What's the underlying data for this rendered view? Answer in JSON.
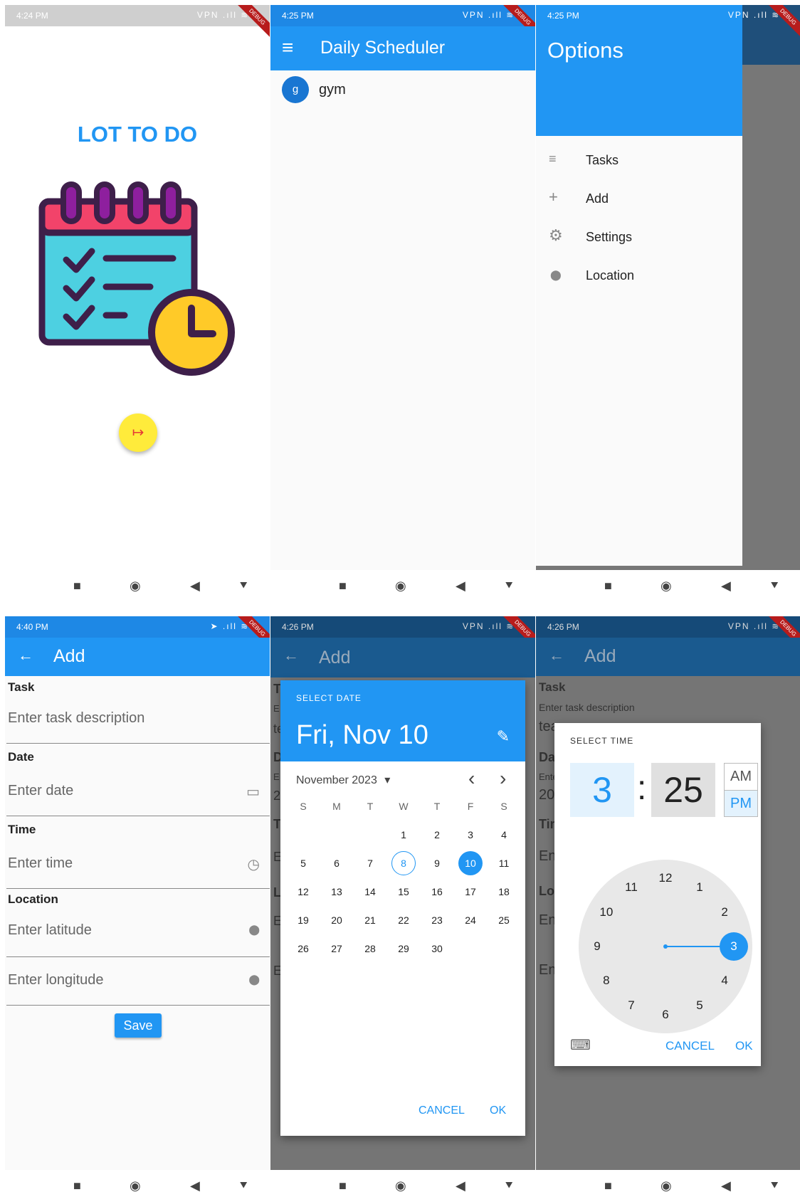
{
  "screen1": {
    "status_time": "4:24 PM",
    "status_icons": "VPN .ıll ≋ ▭",
    "debug": "DEBUG",
    "title": "LOT TO DO",
    "next_icon": "↦"
  },
  "screen2": {
    "status_time": "4:25 PM",
    "status_icons": "VPN .ıll ≋ ▭",
    "debug": "DEBUG",
    "app_title": "Daily Scheduler",
    "menu_icon": "≡",
    "items": [
      {
        "avatar": "g",
        "label": "gym"
      }
    ]
  },
  "screen3": {
    "status_time": "4:25 PM",
    "status_icons": "VPN .ıll ≋ ▭",
    "debug": "DEBUG",
    "drawer_title": "Options",
    "items": [
      {
        "icon": "≡",
        "label": "Tasks"
      },
      {
        "icon": "+",
        "label": "Add"
      },
      {
        "icon": "⚙",
        "label": "Settings"
      },
      {
        "icon": "⬤",
        "label": "Location"
      }
    ]
  },
  "screen4": {
    "status_time": "4:40 PM",
    "status_icons": "➤ .ıll ≋ ▭",
    "debug": "DEBUG",
    "back_icon": "←",
    "app_title": "Add",
    "task_label": "Task",
    "task_placeholder": "Enter task description",
    "date_label": "Date",
    "date_placeholder": "Enter date",
    "time_label": "Time",
    "time_placeholder": "Enter time",
    "location_label": "Location",
    "latitude_placeholder": "Enter latitude",
    "longitude_placeholder": "Enter longitude",
    "save_label": "Save"
  },
  "screen5": {
    "status_time": "4:26 PM",
    "status_icons": "VPN .ıll ≋ ▭",
    "debug": "DEBUG",
    "app_title": "Add",
    "dialog_header": "SELECT DATE",
    "selected_date": "Fri, Nov 10",
    "edit_icon": "✎",
    "month_label": "November 2023",
    "dropdown_icon": "▾",
    "prev_icon": "‹",
    "next_icon": "›",
    "weekdays": [
      "S",
      "M",
      "T",
      "W",
      "T",
      "F",
      "S"
    ],
    "weeks": [
      [
        "",
        "",
        "",
        "1",
        "2",
        "3",
        "4"
      ],
      [
        "5",
        "6",
        "7",
        "8",
        "9",
        "10",
        "11"
      ],
      [
        "12",
        "13",
        "14",
        "15",
        "16",
        "17",
        "18"
      ],
      [
        "19",
        "20",
        "21",
        "22",
        "23",
        "24",
        "25"
      ],
      [
        "26",
        "27",
        "28",
        "29",
        "30",
        "",
        ""
      ]
    ],
    "today": "8",
    "selected": "10",
    "cancel_label": "CANCEL",
    "ok_label": "OK",
    "bg_fragments": [
      "T",
      "E",
      "te",
      "D",
      "E",
      "2",
      "T",
      "E",
      "L",
      "E",
      "E"
    ]
  },
  "screen6": {
    "status_time": "4:26 PM",
    "status_icons": "VPN .ıll ≋ ▭",
    "debug": "DEBUG",
    "back_icon": "←",
    "app_title": "Add",
    "bg_task_label": "Task",
    "bg_task_hint": "Enter task description",
    "bg_task_value": "tea",
    "bg_fragments": [
      "Dat",
      "Ente",
      "202",
      "Tim",
      "Ent",
      "Loc",
      "Ent",
      "Ent"
    ],
    "dialog_header": "SELECT TIME",
    "hour": "3",
    "colon": ":",
    "minute": "25",
    "am_label": "AM",
    "pm_label": "PM",
    "selected_period": "PM",
    "clock_numbers": [
      "12",
      "1",
      "2",
      "3",
      "4",
      "5",
      "6",
      "7",
      "8",
      "9",
      "10",
      "11"
    ],
    "selected_number": "3",
    "keyboard_icon": "⌨",
    "cancel_label": "CANCEL",
    "ok_label": "OK"
  },
  "nav_icons": {
    "recent": "■",
    "home": "◉",
    "back": "◀",
    "extra": "⯆"
  },
  "colors": {
    "primary": "#2196F3",
    "primary_dark": "#1565C0",
    "accent_yellow": "#FFEB3B",
    "scrim": "#757575"
  }
}
